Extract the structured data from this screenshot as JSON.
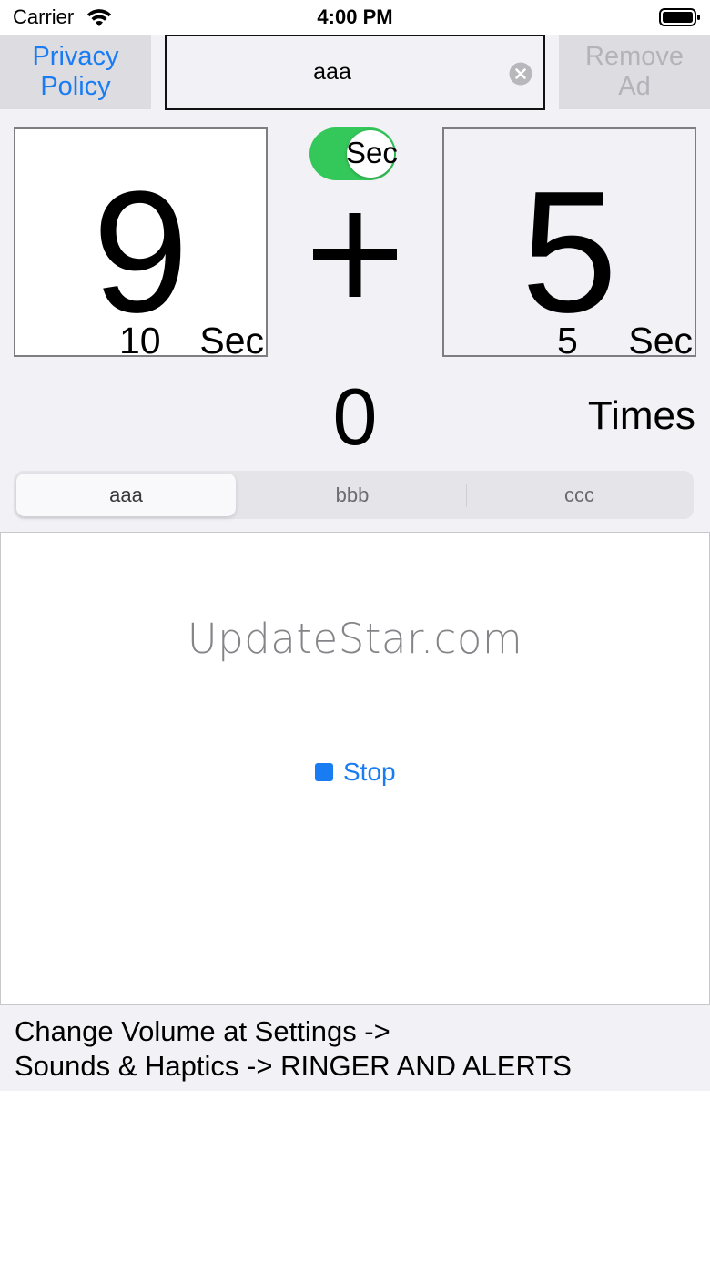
{
  "status_bar": {
    "carrier": "Carrier",
    "time": "4:00 PM",
    "wifi_icon": "wifi-icon",
    "battery_icon": "battery-icon"
  },
  "header": {
    "privacy_line1": "Privacy",
    "privacy_line2": "Policy",
    "name_field_value": "aaa",
    "clear_icon": "clear-circle-icon",
    "remove_ad_line1": "Remove",
    "remove_ad_line2": "Ad"
  },
  "timer": {
    "left_digit": "9",
    "left_seconds": "10",
    "left_unit": "Sec",
    "toggle_label": "Sec",
    "toggle_on": true,
    "operator": "+",
    "right_digit": "5",
    "right_seconds": "5",
    "right_unit": "Sec"
  },
  "counter": {
    "value": "0",
    "label": "Times"
  },
  "segments": {
    "items": [
      "aaa",
      "bbb",
      "ccc"
    ],
    "selected": "aaa"
  },
  "ad": {
    "text": "UpdateStar.com",
    "stop_label": "Stop",
    "stop_icon": "stop-square-icon"
  },
  "footer": {
    "line1": "Change Volume at Settings ->",
    "line2": "Sounds & Haptics -> RINGER AND ALERTS"
  },
  "colors": {
    "accent": "#1a7cf2",
    "toggle_on": "#34c759",
    "background": "#f1f1f6"
  }
}
